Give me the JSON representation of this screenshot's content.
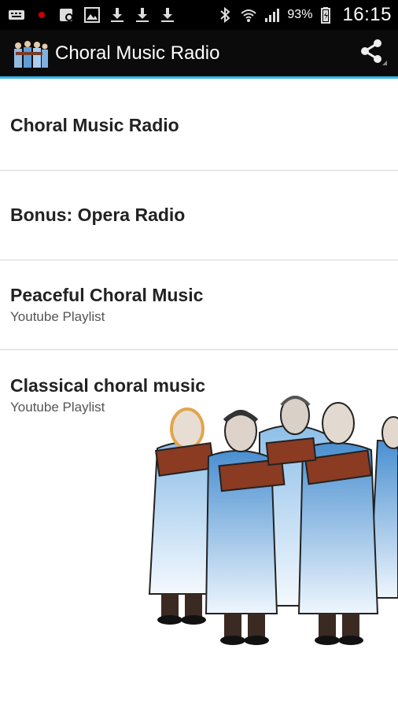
{
  "status_bar": {
    "battery_percent": "93%",
    "time": "16:15",
    "left_icons": [
      "keyboard-icon",
      "notification-dot-icon",
      "phone-tool-icon",
      "image-icon",
      "download-icon",
      "download-icon",
      "download-icon"
    ],
    "right_icons": [
      "bluetooth-icon",
      "wifi-icon",
      "signal-icon",
      "battery-icon"
    ]
  },
  "app_bar": {
    "title": "Choral Music Radio",
    "accent_color": "#33b5e5"
  },
  "list": {
    "items": [
      {
        "title": "Choral Music Radio",
        "subtitle": ""
      },
      {
        "title": "Bonus: Opera Radio",
        "subtitle": ""
      },
      {
        "title": "Peaceful Choral Music",
        "subtitle": "Youtube Playlist"
      },
      {
        "title": "Classical choral music",
        "subtitle": "Youtube Playlist"
      }
    ]
  }
}
